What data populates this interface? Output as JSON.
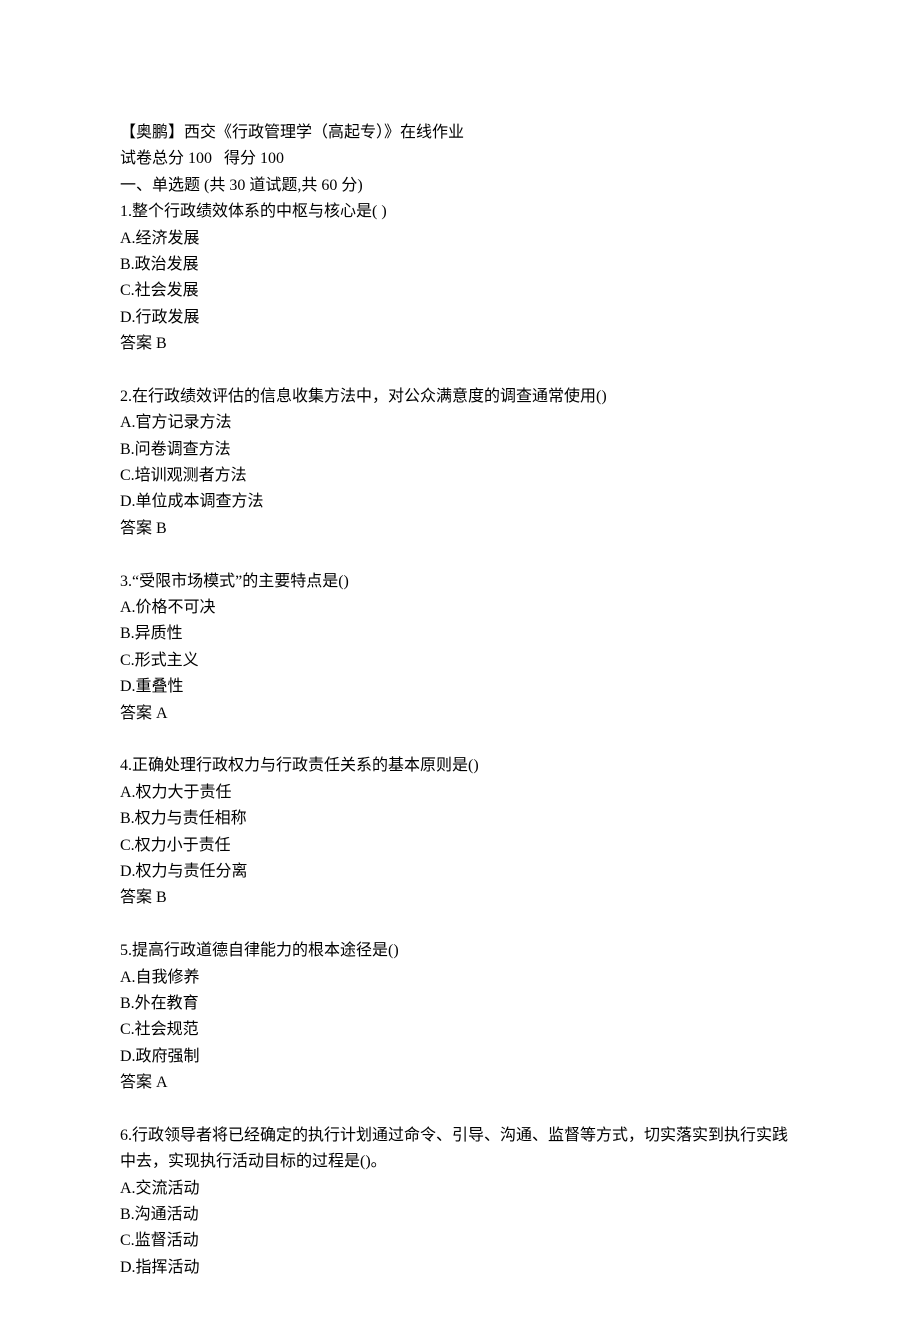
{
  "header": {
    "title": "【奥鹏】西交《行政管理学（高起专）》在线作业",
    "score_line": "试卷总分 100   得分 100",
    "section_title": "一、单选题 (共 30 道试题,共 60 分)"
  },
  "questions": [
    {
      "stem": "1.整个行政绩效体系的中枢与核心是( )",
      "options": [
        "A.经济发展",
        "B.政治发展",
        "C.社会发展",
        "D.行政发展"
      ],
      "answer": "答案 B"
    },
    {
      "stem": "2.在行政绩效评估的信息收集方法中，对公众满意度的调查通常使用()",
      "options": [
        "A.官方记录方法",
        "B.问卷调查方法",
        "C.培训观测者方法",
        "D.单位成本调查方法"
      ],
      "answer": "答案 B"
    },
    {
      "stem": "3.“受限市场模式”的主要特点是()",
      "options": [
        "A.价格不可决",
        "B.异质性",
        "C.形式主义",
        "D.重叠性"
      ],
      "answer": "答案 A"
    },
    {
      "stem": "4.正确处理行政权力与行政责任关系的基本原则是()",
      "options": [
        "A.权力大于责任",
        "B.权力与责任相称",
        "C.权力小于责任",
        "D.权力与责任分离"
      ],
      "answer": "答案 B"
    },
    {
      "stem": "5.提高行政道德自律能力的根本途径是()",
      "options": [
        "A.自我修养",
        "B.外在教育",
        "C.社会规范",
        "D.政府强制"
      ],
      "answer": "答案 A"
    },
    {
      "stem": "6.行政领导者将已经确定的执行计划通过命令、引导、沟通、监督等方式，切实落实到执行实践中去，实现执行活动目标的过程是()。",
      "options": [
        "A.交流活动",
        "B.沟通活动",
        "C.监督活动",
        "D.指挥活动"
      ],
      "answer": null
    }
  ]
}
